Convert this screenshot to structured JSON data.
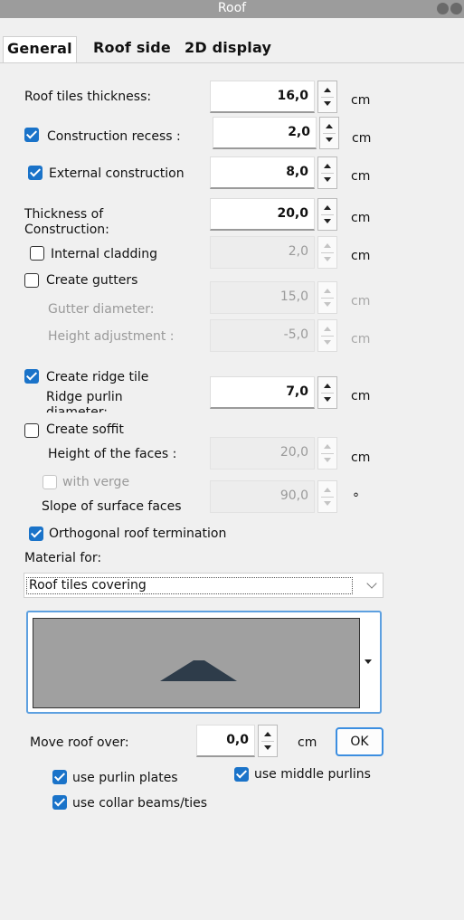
{
  "window": {
    "title": "Roof"
  },
  "tabs": [
    {
      "label": "General"
    },
    {
      "label": "Roof side"
    },
    {
      "label": "2D display"
    }
  ],
  "fields": {
    "roof_tiles_thickness": {
      "label": "Roof tiles thickness:",
      "value": "16,0",
      "unit": "cm"
    },
    "construction_recess": {
      "label": "Construction recess :",
      "value": "2,0",
      "unit": "cm",
      "checked": true
    },
    "external_construction": {
      "label": "External construction",
      "value": "8,0",
      "unit": "cm",
      "checked": true
    },
    "thickness_of_construction": {
      "label": "Thickness of Construction:",
      "value": "20,0",
      "unit": "cm"
    },
    "internal_cladding": {
      "label": "Internal cladding",
      "value": "2,0",
      "unit": "cm",
      "checked": false
    },
    "create_gutters": {
      "label": "Create gutters",
      "checked": false
    },
    "gutter_diameter": {
      "label": "Gutter diameter:",
      "value": "15,0",
      "unit": "cm"
    },
    "height_adjustment": {
      "label": "Height adjustment :",
      "value": "-5,0",
      "unit": "cm"
    },
    "create_ridge_tile": {
      "label": "Create ridge tile",
      "checked": true
    },
    "ridge_purlin_diameter": {
      "label": "Ridge purlin diameter:",
      "value": "7,0",
      "unit": "cm"
    },
    "create_soffit": {
      "label": "Create soffit",
      "checked": false
    },
    "height_of_faces": {
      "label": "Height of the faces :",
      "value": "20,0",
      "unit": "cm"
    },
    "with_verge": {
      "label": "with verge",
      "checked": false
    },
    "slope_of_surface_faces": {
      "label": "Slope of surface faces",
      "value": "90,0",
      "unit": "°"
    },
    "orthogonal_roof_termination": {
      "label": "Orthogonal roof termination",
      "checked": true
    }
  },
  "material": {
    "label": "Material for:",
    "selected": "Roof tiles covering"
  },
  "move_roof": {
    "label": "Move roof over:",
    "value": "0,0",
    "unit": "cm",
    "ok_label": "OK"
  },
  "options": {
    "use_purlin_plates": {
      "label": "use purlin plates",
      "checked": true
    },
    "use_middle_purlins": {
      "label": "use middle purlins",
      "checked": true
    },
    "use_collar_beams": {
      "label": "use collar beams/ties",
      "checked": true
    }
  },
  "colors": {
    "accent": "#1a73c9",
    "titlebar": "#9c9c9c",
    "preview_fill": "#a0a0a0",
    "roof_shape": "#2e3c4a"
  }
}
